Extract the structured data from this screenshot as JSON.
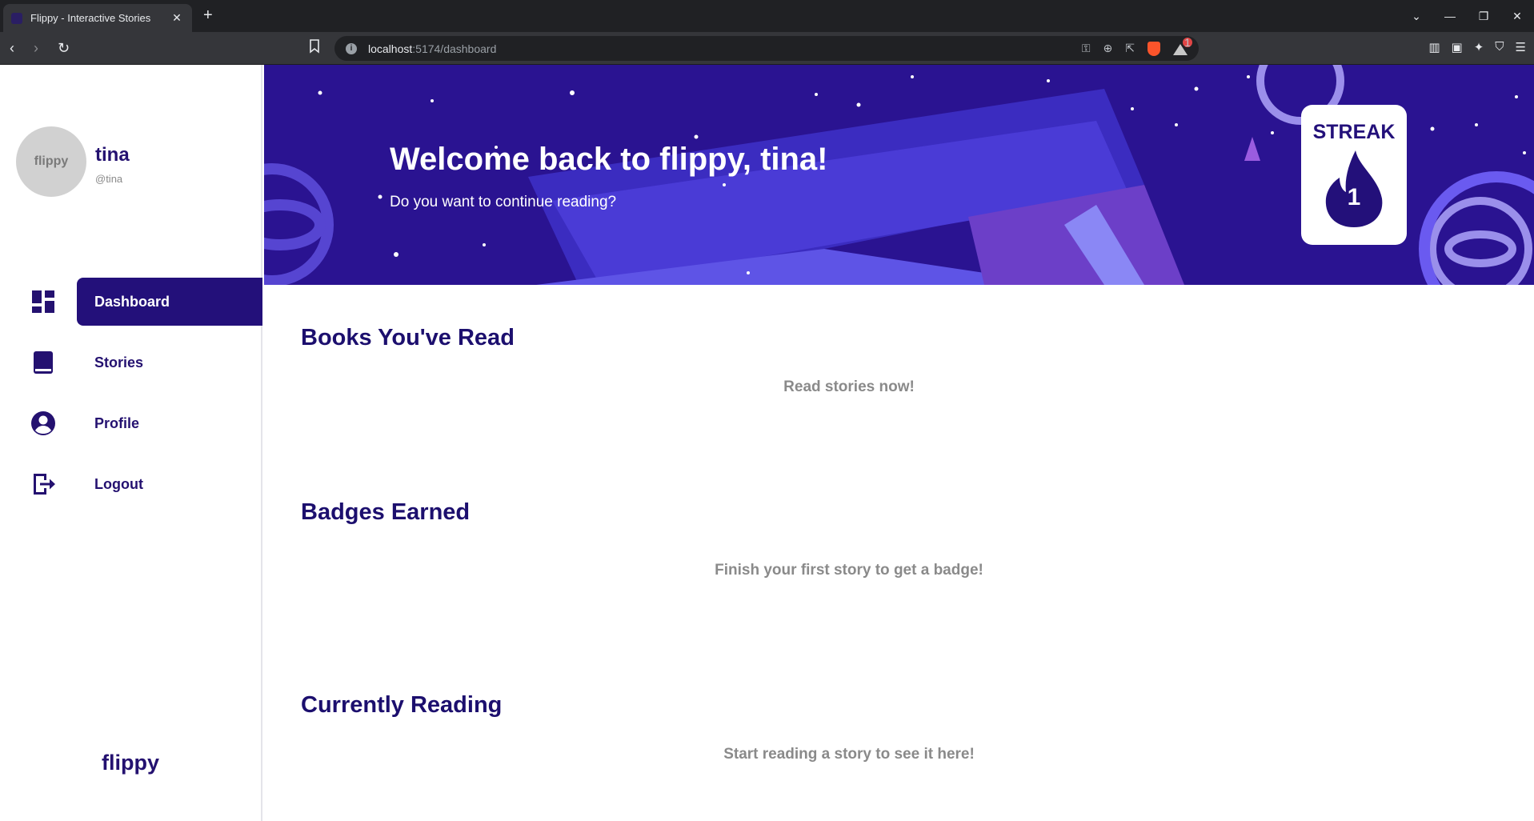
{
  "browser": {
    "tab_title": "Flippy - Interactive Stories",
    "url_host": "localhost",
    "url_rest": ":5174/dashboard",
    "window_controls": [
      "⌄",
      "—",
      "❐",
      "✕"
    ]
  },
  "user": {
    "avatar_text": "flippy",
    "name": "tina",
    "handle": "@tina"
  },
  "sidebar": {
    "items": [
      {
        "label": "Dashboard",
        "icon": "dashboard-icon",
        "active": true
      },
      {
        "label": "Stories",
        "icon": "book-icon",
        "active": false
      },
      {
        "label": "Profile",
        "icon": "account-circle-icon",
        "active": false
      },
      {
        "label": "Logout",
        "icon": "logout-icon",
        "active": false
      }
    ],
    "brand": "flippy"
  },
  "hero": {
    "title": "Welcome back to flippy, tina!",
    "subtitle": "Do you want to continue reading?",
    "streak_label": "STREAK",
    "streak_count": "1"
  },
  "sections": [
    {
      "title": "Books You've Read",
      "empty_text": "Read stories now!"
    },
    {
      "title": "Badges Earned",
      "empty_text": "Finish your first story to get a badge!"
    },
    {
      "title": "Currently Reading",
      "empty_text": "Start reading a story to see it here!"
    }
  ],
  "colors": {
    "primary": "#23107a",
    "hero_bg": "#2a1391",
    "muted_text": "#8a8a8a"
  }
}
